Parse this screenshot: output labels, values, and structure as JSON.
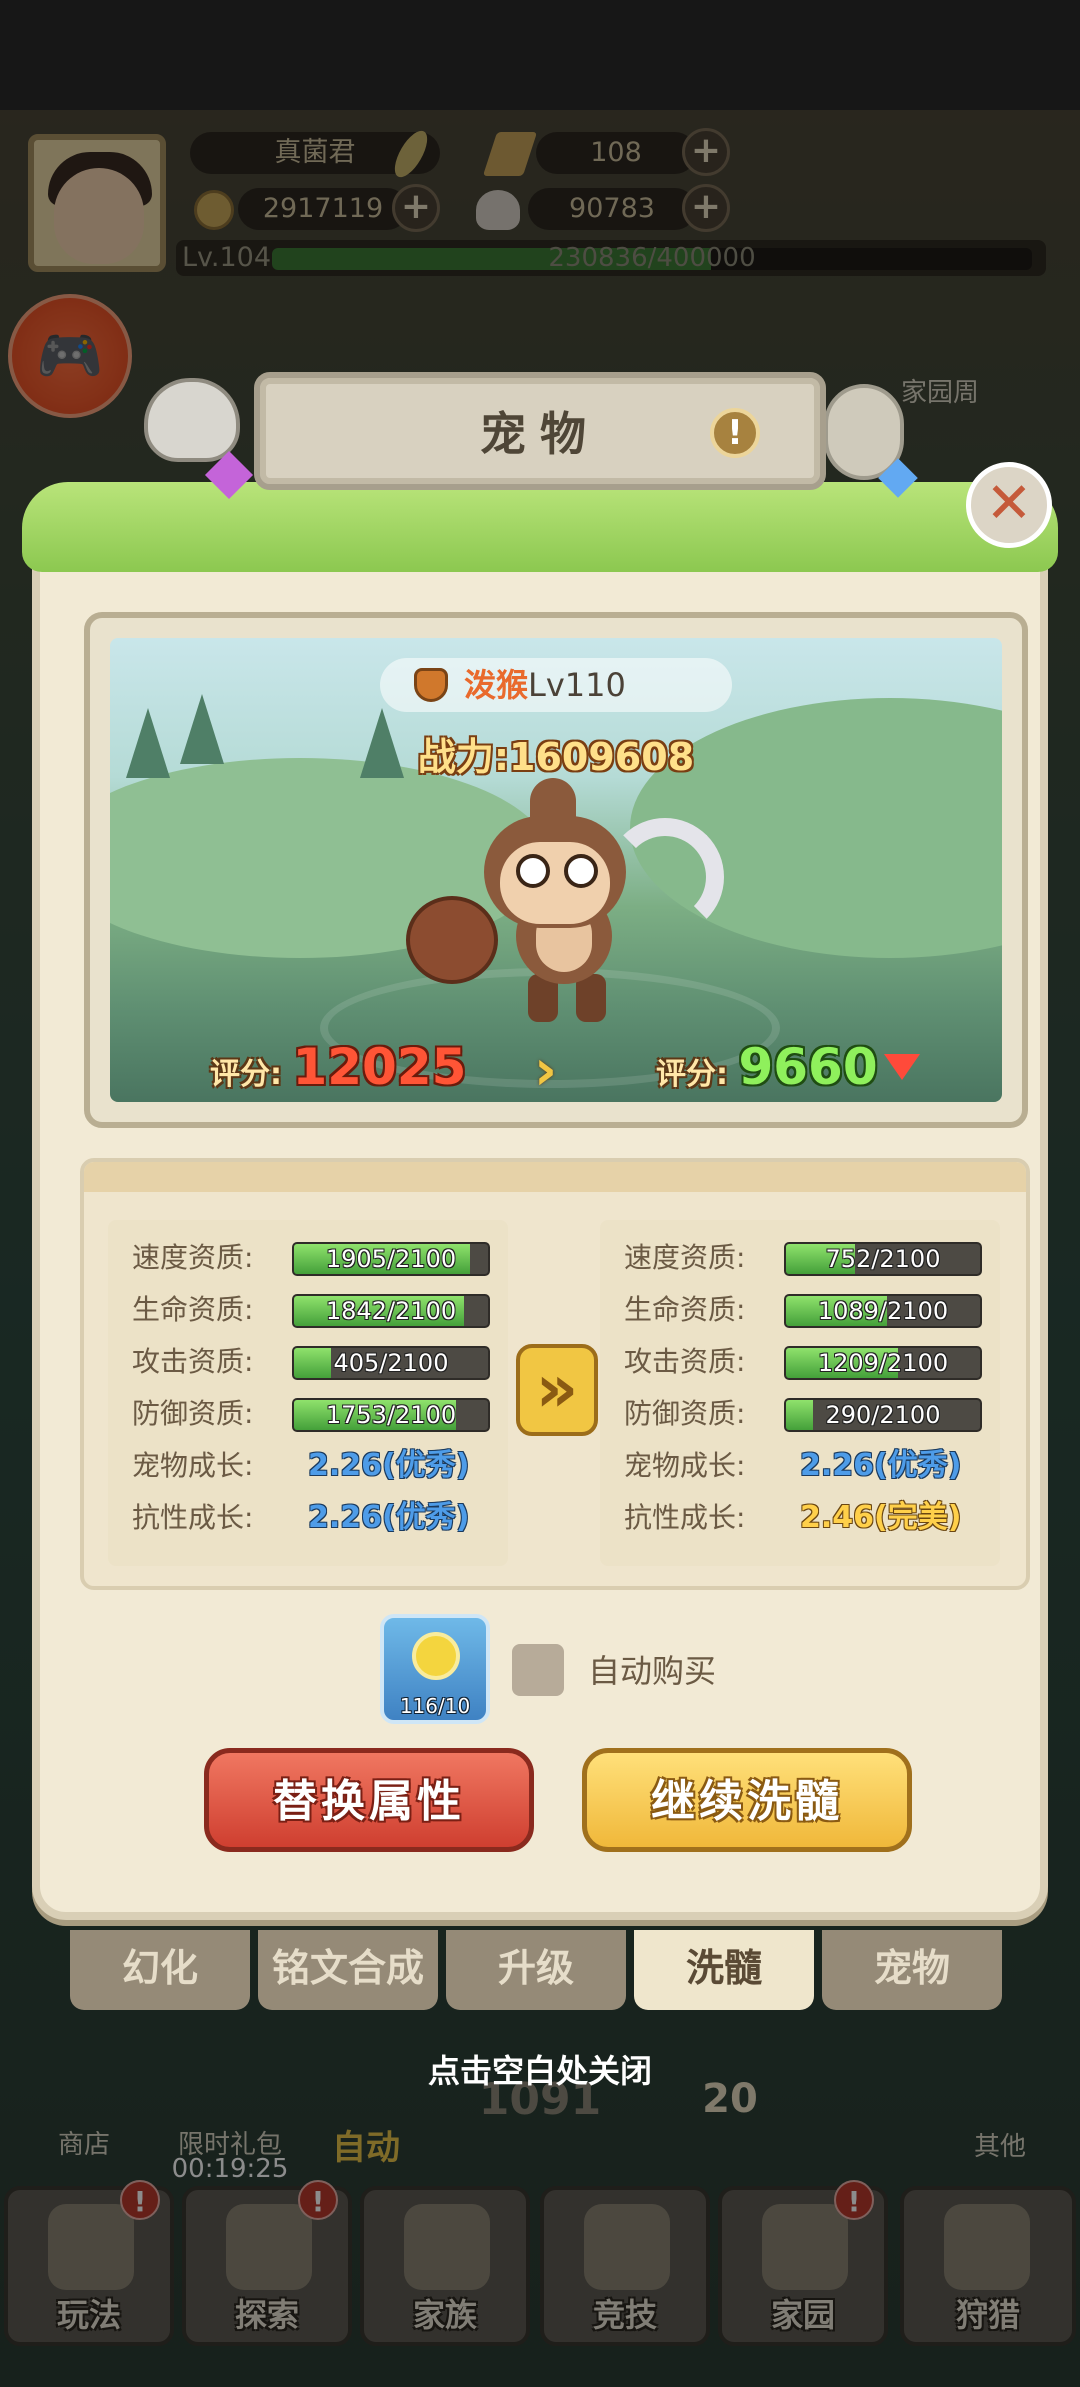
{
  "player": {
    "name": "真菌君",
    "tickets": "108",
    "coins": "2917119",
    "shells": "90783",
    "level_label": "Lv.104",
    "exp": "230836/400000",
    "exp_fraction": 0.577
  },
  "hud_extra": {
    "home_week": "家园周"
  },
  "panel": {
    "title": "宠物",
    "info_icon": "!",
    "close_icon": "✕"
  },
  "pet": {
    "name": "泼猴",
    "level": "Lv110",
    "power_label": "战力:",
    "power_value": "1609608",
    "score_label": "评分:",
    "score_current": "12025",
    "score_new": "9660"
  },
  "stats": {
    "current": [
      {
        "label": "速度资质:",
        "value": "1905/2100",
        "fraction": 0.907
      },
      {
        "label": "生命资质:",
        "value": "1842/2100",
        "fraction": 0.877
      },
      {
        "label": "攻击资质:",
        "value": "405/2100",
        "fraction": 0.193
      },
      {
        "label": "防御资质:",
        "value": "1753/2100",
        "fraction": 0.835
      }
    ],
    "current_growth": [
      {
        "label": "宠物成长:",
        "value": "2.26(优秀)",
        "tier": "blue"
      },
      {
        "label": "抗性成长:",
        "value": "2.26(优秀)",
        "tier": "blue"
      }
    ],
    "new": [
      {
        "label": "速度资质:",
        "value": "752/2100",
        "fraction": 0.358
      },
      {
        "label": "生命资质:",
        "value": "1089/2100",
        "fraction": 0.519
      },
      {
        "label": "攻击资质:",
        "value": "1209/2100",
        "fraction": 0.576
      },
      {
        "label": "防御资质:",
        "value": "290/2100",
        "fraction": 0.138
      }
    ],
    "new_growth": [
      {
        "label": "宠物成长:",
        "value": "2.26(优秀)",
        "tier": "blue"
      },
      {
        "label": "抗性成长:",
        "value": "2.46(完美)",
        "tier": "gold"
      }
    ]
  },
  "item": {
    "count": "116/10",
    "auto_buy_label": "自动购买"
  },
  "buttons": {
    "replace": "替换属性",
    "continue": "继续洗髓"
  },
  "tabs": [
    {
      "label": "幻化",
      "active": false
    },
    {
      "label": "铭文合成",
      "active": false
    },
    {
      "label": "升级",
      "active": false
    },
    {
      "label": "洗髓",
      "active": true
    },
    {
      "label": "宠物",
      "active": false
    }
  ],
  "close_hint": "点击空白处关闭",
  "background": {
    "shop": "商店",
    "gift": "限时礼包",
    "gift_timer": "00:19:25",
    "auto": "自动",
    "stage_number": "1091",
    "stage_badge": "20",
    "other": "其他"
  },
  "bottom_nav": [
    {
      "label": "玩法",
      "badge": "!"
    },
    {
      "label": "探索",
      "badge": "!"
    },
    {
      "label": "家族",
      "badge": ""
    },
    {
      "label": "竞技",
      "badge": ""
    },
    {
      "label": "家园",
      "badge": "!"
    },
    {
      "label": "狩猎",
      "badge": ""
    }
  ],
  "colors": {
    "accent_red": "#cf3f30",
    "accent_gold": "#f0b83a",
    "bar_green": "#44a03a",
    "score_red": "#ff5536",
    "score_green": "#8ff05c"
  }
}
